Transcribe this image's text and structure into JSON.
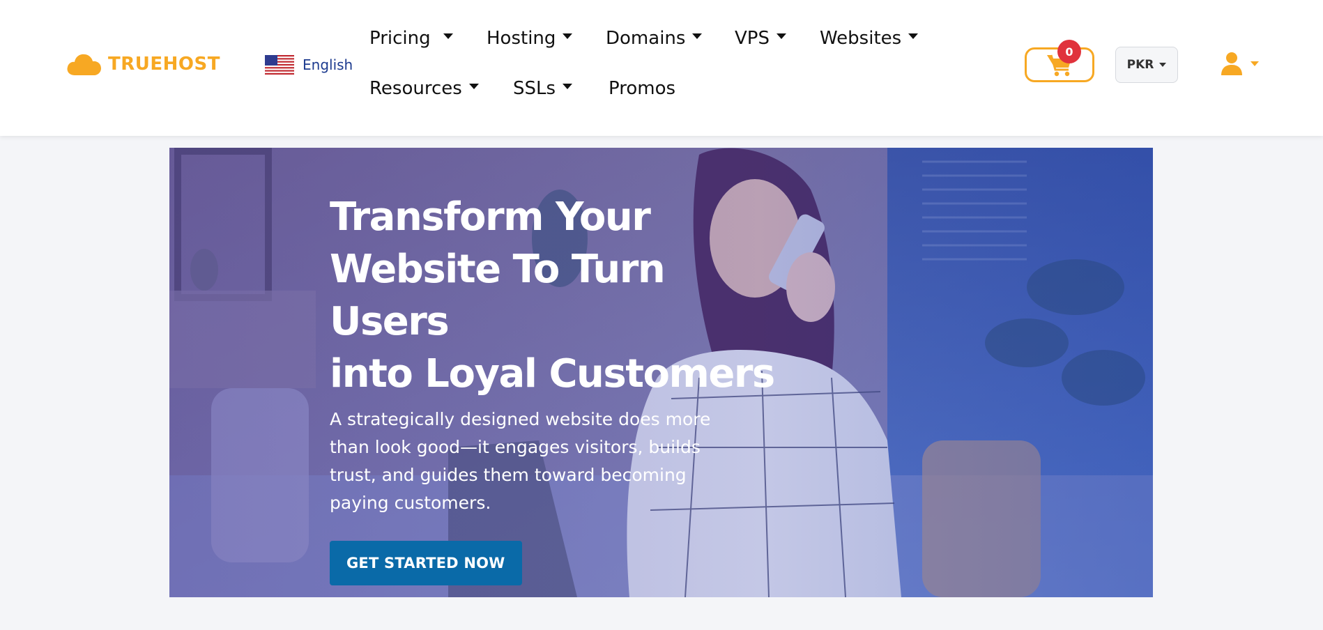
{
  "brand": {
    "name": "TRUEHOST",
    "color": "#f7a823"
  },
  "language": {
    "flag": "us-flag-icon",
    "label": "English"
  },
  "nav": {
    "items": [
      {
        "label": "Pricing",
        "has_dropdown": true
      },
      {
        "label": "Hosting",
        "has_dropdown": true
      },
      {
        "label": "Domains",
        "has_dropdown": true
      },
      {
        "label": "VPS",
        "has_dropdown": true
      },
      {
        "label": "Websites",
        "has_dropdown": true
      },
      {
        "label": "Resources",
        "has_dropdown": true
      },
      {
        "label": "SSLs",
        "has_dropdown": true
      },
      {
        "label": "Promos",
        "has_dropdown": false
      }
    ]
  },
  "cart": {
    "icon": "cart-icon",
    "count": "0",
    "badge_color": "#e0323c"
  },
  "currency": {
    "selected": "PKR"
  },
  "user": {
    "icon": "user-icon"
  },
  "hero": {
    "title_lines": [
      "Transform Your",
      "Website To Turn Users",
      "into Loyal Customers"
    ],
    "subtitle": "A strategically designed website does more than look good—it engages visitors, builds trust, and guides them toward becoming paying customers.",
    "cta_label": "GET STARTED NOW",
    "cta_color": "#0a6aa8"
  }
}
